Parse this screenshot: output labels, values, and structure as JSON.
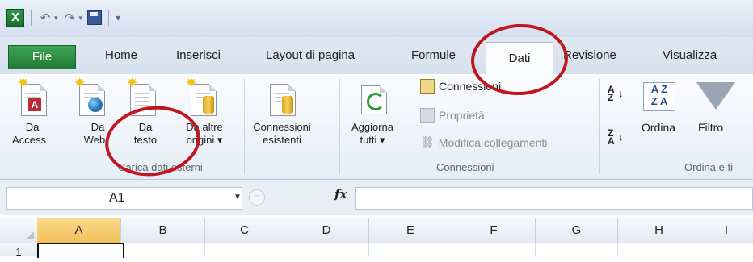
{
  "quick_access": {
    "app_icon": "X"
  },
  "tabs": {
    "file": "File",
    "home": "Home",
    "insert": "Inserisci",
    "layout": "Layout di pagina",
    "formulas": "Formule",
    "data": "Dati",
    "review": "Revisione",
    "view": "Visualizza"
  },
  "ribbon": {
    "get_external": {
      "label": "Carica dati esterni",
      "access_1": "Da",
      "access_2": "Access",
      "web_1": "Da",
      "web_2": "Web",
      "text_1": "Da",
      "text_2": "testo",
      "other_1": "Da altre",
      "other_2": "origini ▾",
      "existing_1": "Connessioni",
      "existing_2": "esistenti"
    },
    "connections": {
      "label": "Connessioni",
      "refresh_1": "Aggiorna",
      "refresh_2": "tutti ▾",
      "conn": "Connessioni",
      "props": "Proprietà",
      "edit_links": "Modifica collegamenti"
    },
    "sort_filter": {
      "label": "Ordina e fi",
      "sort": "Ordina",
      "filter": "Filtro"
    }
  },
  "formula_bar": {
    "name_box": "A1",
    "fx": "fx",
    "formula": ""
  },
  "grid": {
    "columns": [
      "A",
      "B",
      "C",
      "D",
      "E",
      "F",
      "G",
      "H",
      "I"
    ],
    "row1": "1"
  },
  "colors": {
    "annotation": "#c0161d",
    "file_tab": "#217a34",
    "active_header": "#f2c15a"
  }
}
